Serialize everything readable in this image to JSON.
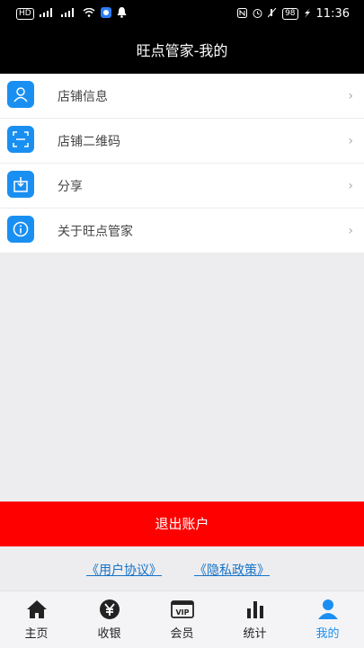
{
  "status_bar": {
    "left_items": [
      "HD",
      "4G",
      "4G"
    ],
    "battery": "98",
    "time": "11:36"
  },
  "title": "旺点管家-我的",
  "menu": [
    {
      "label": "店铺信息",
      "icon": "person-icon"
    },
    {
      "label": "店铺二维码",
      "icon": "qr-scan-icon"
    },
    {
      "label": "分享",
      "icon": "share-icon"
    },
    {
      "label": "关于旺点管家",
      "icon": "info-icon"
    }
  ],
  "logout_label": "退出账户",
  "links": {
    "user_agreement": "《用户协议》",
    "privacy_policy": "《隐私政策》"
  },
  "tabs": [
    {
      "label": "主页",
      "icon": "home-icon"
    },
    {
      "label": "收银",
      "icon": "yen-icon"
    },
    {
      "label": "会员",
      "icon": "vip-icon"
    },
    {
      "label": "统计",
      "icon": "bar-chart-icon"
    },
    {
      "label": "我的",
      "icon": "user-icon",
      "active": true
    }
  ],
  "colors": {
    "accent": "#1a8ff2",
    "logout": "#ff0000",
    "link": "#1673c7"
  }
}
